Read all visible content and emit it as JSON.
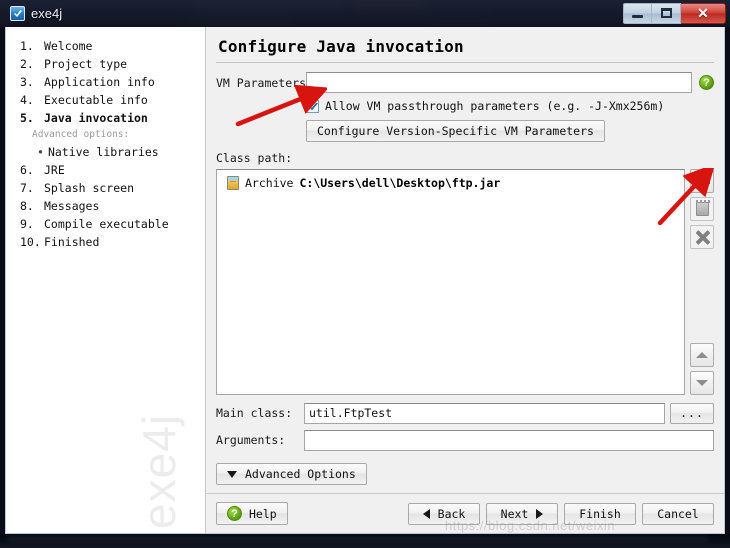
{
  "window": {
    "title": "exe4j",
    "app_icon": "exe4j-icon",
    "controls": {
      "minimize": "minimize-icon",
      "maximize": "maximize-icon",
      "close": "✕"
    }
  },
  "sidebar": {
    "items": [
      {
        "num": "1.",
        "label": "Welcome",
        "current": false
      },
      {
        "num": "2.",
        "label": "Project type",
        "current": false
      },
      {
        "num": "3.",
        "label": "Application info",
        "current": false
      },
      {
        "num": "4.",
        "label": "Executable info",
        "current": false
      },
      {
        "num": "5.",
        "label": "Java invocation",
        "current": true
      }
    ],
    "advanced_label": "Advanced options:",
    "sub_items": [
      {
        "bullet": "•",
        "label": "Native libraries"
      }
    ],
    "items_after": [
      {
        "num": "6.",
        "label": "JRE",
        "current": false
      },
      {
        "num": "7.",
        "label": "Splash screen",
        "current": false
      },
      {
        "num": "8.",
        "label": "Messages",
        "current": false
      },
      {
        "num": "9.",
        "label": "Compile executable",
        "current": false
      },
      {
        "num": "10.",
        "label": "Finished",
        "current": false
      }
    ],
    "watermark": "exe4j"
  },
  "main": {
    "title": "Configure Java invocation",
    "vm_parameters": {
      "label": "VM Parameters:",
      "value": "",
      "placeholder": "",
      "help_icon": "?"
    },
    "passthrough": {
      "checked": true,
      "label": "Allow VM passthrough parameters (e.g. -J-Xmx256m)"
    },
    "version_specific_button": "Configure Version-Specific VM Parameters",
    "classpath": {
      "label": "Class path:",
      "entries": [
        {
          "icon": "jar-icon",
          "kind": "Archive",
          "path": "C:\\Users\\dell\\Desktop\\ftp.jar"
        }
      ],
      "tools": {
        "add": "add-icon",
        "edit": "edit-icon",
        "remove": "remove-icon",
        "move_up": "chevron-up-icon",
        "move_down": "chevron-down-icon"
      }
    },
    "main_class": {
      "label": "Main class:",
      "value": "util.FtpTest",
      "browse_label": "..."
    },
    "arguments": {
      "label": "Arguments:",
      "value": "",
      "placeholder": ""
    },
    "advanced_options_button": "Advanced Options"
  },
  "footer": {
    "help": "Help",
    "back": "Back",
    "next": "Next",
    "finish": "Finish",
    "cancel": "Cancel"
  },
  "overlay_watermark": "https://blog.csdn.net/weixin",
  "colors": {
    "accent_green": "#3faa1e",
    "close_red": "#cf3f34",
    "annotation_red": "#d8140f",
    "dialog_bg": "#f0f0f0",
    "field_bg": "#ffffff"
  }
}
